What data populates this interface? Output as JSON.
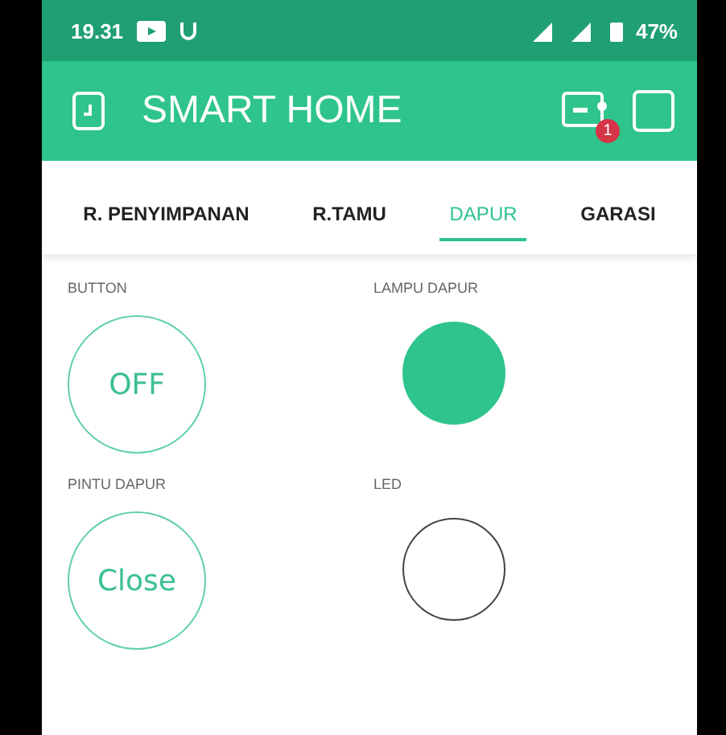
{
  "status_bar": {
    "time": "19.31",
    "battery": "47%"
  },
  "header": {
    "title": "SMART HOME",
    "notification_badge": "1"
  },
  "tabs": [
    {
      "label": "R. PENYIMPANAN",
      "selected": false
    },
    {
      "label": "R.TAMU",
      "selected": false
    },
    {
      "label": "DAPUR",
      "selected": true
    },
    {
      "label": "GARASI",
      "selected": false
    }
  ],
  "widgets": [
    {
      "kind": "button",
      "label": "BUTTON",
      "text": "OFF"
    },
    {
      "kind": "led",
      "label": "LAMPU DAPUR",
      "on": true
    },
    {
      "kind": "button",
      "label": "PINTU DAPUR",
      "text": "Close"
    },
    {
      "kind": "led",
      "label": "LED",
      "on": false
    }
  ]
}
